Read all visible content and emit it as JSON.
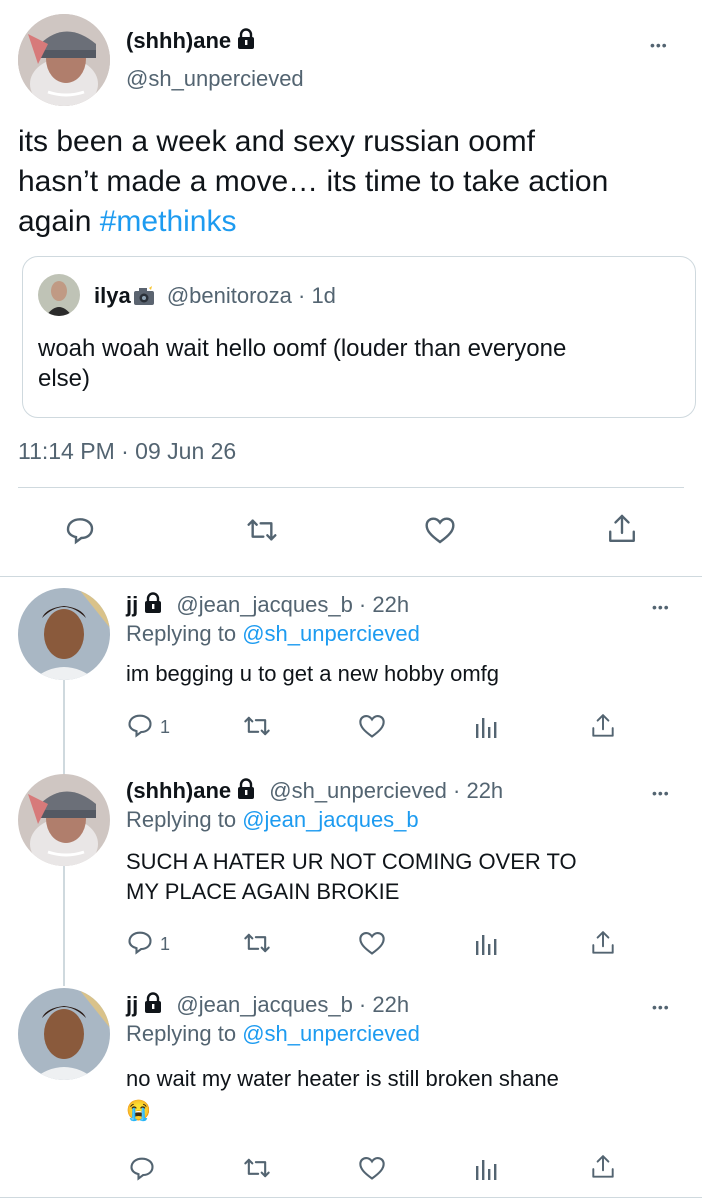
{
  "main_tweet": {
    "display_name": "(shhh)ane",
    "handle": "@sh_unpercieved",
    "text_line1": "its been a week and sexy russian oomf",
    "text_line2": "hasn’t made a move… its time to take action",
    "text_line3_prefix": "again ",
    "hashtag": "#methinks",
    "timestamp": "11:14 PM · 09 Jun 26",
    "more": "•••"
  },
  "quoted_tweet": {
    "display_name": "ilya",
    "handle_time": "@benitoroza · 1d",
    "text_line1": "woah woah wait hello oomf (louder than everyone",
    "text_line2": "else)"
  },
  "replies": [
    {
      "display_name": "jj",
      "handle_time": "@jean_jacques_b · 22h",
      "replying_prefix": "Replying to ",
      "replying_to": "@sh_unpercieved",
      "text_line1": "im begging u to get a new hobby omfg",
      "reply_count": "1",
      "more": "•••"
    },
    {
      "display_name": "(shhh)ane",
      "handle_time": "@sh_unpercieved · 22h",
      "replying_prefix": "Replying to ",
      "replying_to": "@jean_jacques_b",
      "text_line1": "SUCH A HATER UR NOT COMING OVER TO",
      "text_line2": "MY PLACE AGAIN BROKIE",
      "reply_count": "1",
      "more": "•••"
    },
    {
      "display_name": "jj",
      "handle_time": "@jean_jacques_b · 22h",
      "replying_prefix": "Replying to ",
      "replying_to": "@sh_unpercieved",
      "text_line1": "no wait my water heater is still broken shane",
      "text_line2": "😭",
      "more": "•••"
    }
  ],
  "colors": {
    "accent": "#1d9bf0",
    "muted": "#536471",
    "divider": "#cfd9de"
  },
  "icons": [
    "lock-icon",
    "more-icon",
    "reply-icon",
    "retweet-icon",
    "like-icon",
    "analytics-icon",
    "share-icon",
    "camera-emoji-icon"
  ]
}
